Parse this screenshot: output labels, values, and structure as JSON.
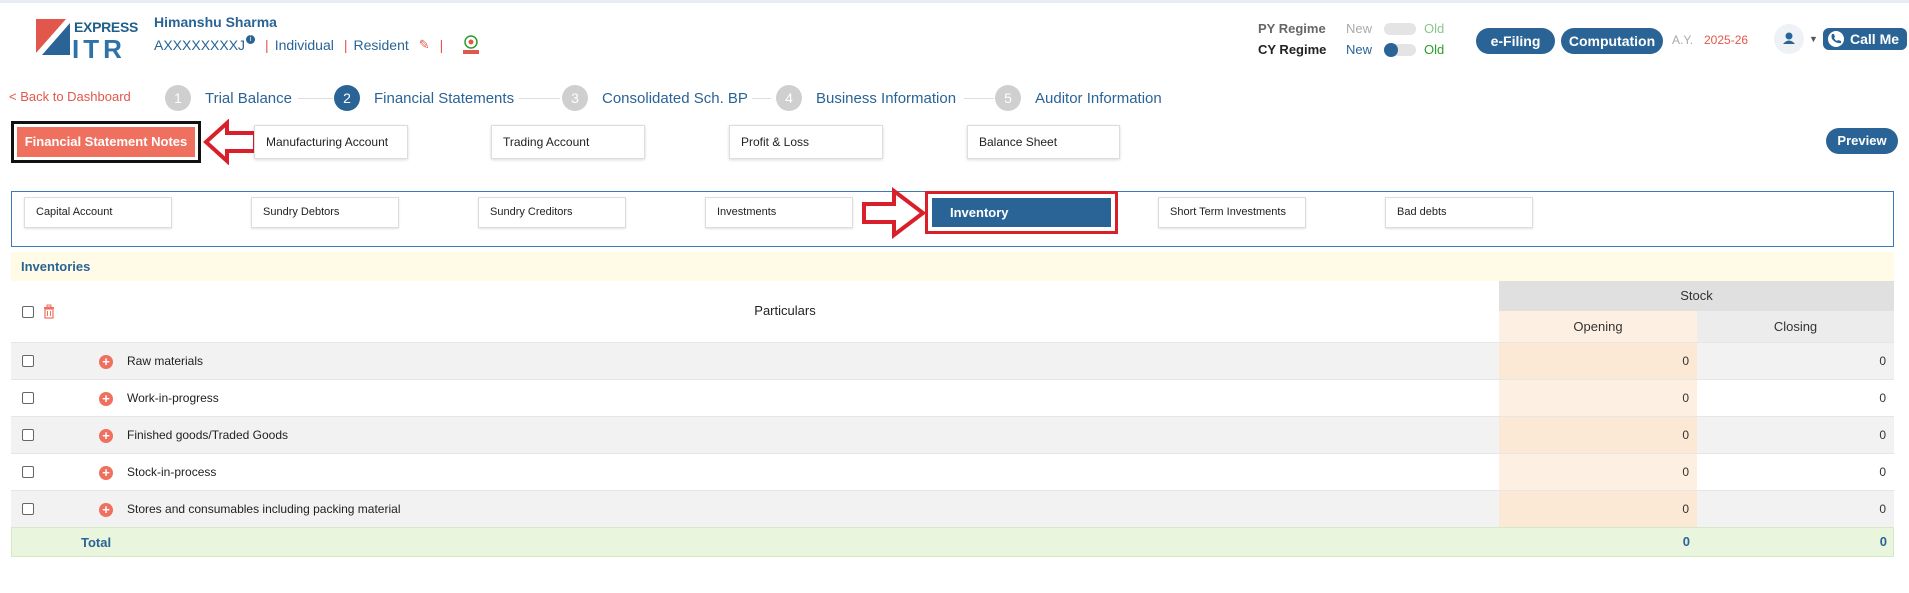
{
  "brand": {
    "express": "EXPRESS",
    "itr": "ITR"
  },
  "user": {
    "name": "Himanshu Sharma",
    "pan": "AXXXXXXXXJ",
    "info": "i",
    "type": "Individual",
    "residency": "Resident"
  },
  "regime": {
    "py_label": "PY Regime",
    "cy_label": "CY Regime",
    "new_label": "New",
    "old_label": "Old"
  },
  "header": {
    "efiling": "e-Filing",
    "computation": "Computation",
    "ay_label": "A.Y.",
    "ay_value": "2025-26",
    "call_me": "Call Me"
  },
  "nav": {
    "back": "< Back to Dashboard"
  },
  "steps": [
    {
      "num": "1",
      "label": "Trial Balance"
    },
    {
      "num": "2",
      "label": "Financial Statements"
    },
    {
      "num": "3",
      "label": "Consolidated Sch. BP"
    },
    {
      "num": "4",
      "label": "Business Information"
    },
    {
      "num": "5",
      "label": "Auditor Information"
    }
  ],
  "main_tabs": [
    "Financial Statement Notes",
    "Manufacturing Account",
    "Trading Account",
    "Profit & Loss",
    "Balance Sheet"
  ],
  "preview": "Preview",
  "sub_tabs": [
    "Capital Account",
    "Sundry Debtors",
    "Sundry Creditors",
    "Investments",
    "Inventory",
    "Short Term Investments",
    "Bad debts"
  ],
  "table": {
    "section": "Inventories",
    "particulars": "Particulars",
    "stock": "Stock",
    "opening": "Opening",
    "closing": "Closing",
    "rows": [
      {
        "label": "Raw materials",
        "opening": "0",
        "closing": "0"
      },
      {
        "label": "Work-in-progress",
        "opening": "0",
        "closing": "0"
      },
      {
        "label": "Finished goods/Traded Goods",
        "opening": "0",
        "closing": "0"
      },
      {
        "label": "Stock-in-process",
        "opening": "0",
        "closing": "0"
      },
      {
        "label": "Stores and consumables including packing material",
        "opening": "0",
        "closing": "0"
      }
    ],
    "total": {
      "label": "Total",
      "opening": "0",
      "closing": "0"
    }
  },
  "icons": {
    "add": "plus-circle-icon",
    "delete": "trash-icon",
    "edit": "pencil-icon",
    "emblem": "emblem-icon",
    "user": "user-icon",
    "phone": "phone-icon"
  },
  "colors": {
    "primary": "#2a6496",
    "accent": "#f07060",
    "highlight": "#d9202a"
  }
}
